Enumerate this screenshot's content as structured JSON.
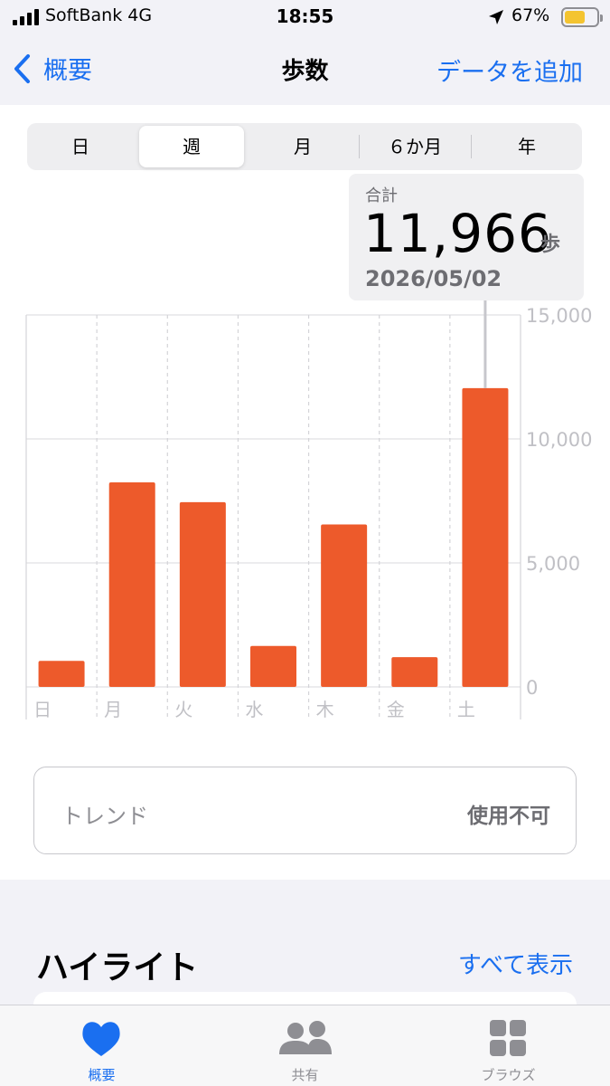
{
  "status_bar": {
    "carrier": "SoftBank   4G",
    "time": "18:55",
    "battery": "67%"
  },
  "nav": {
    "back": "概要",
    "title": "歩数",
    "add": "データを追加"
  },
  "segments": [
    {
      "label": "日",
      "selected": false
    },
    {
      "label": "週",
      "selected": true
    },
    {
      "label": "月",
      "selected": false
    },
    {
      "label": "６か月",
      "selected": false
    },
    {
      "label": "年",
      "selected": false
    }
  ],
  "summary": {
    "label": "合計",
    "value": "11,966",
    "unit": "歩",
    "date": "2026/05/02"
  },
  "chart_data": {
    "type": "bar",
    "categories": [
      "日",
      "月",
      "火",
      "水",
      "木",
      "金",
      "土"
    ],
    "values": [
      1050,
      8250,
      7450,
      1650,
      6550,
      1200,
      12050
    ],
    "highlight_index": 6,
    "ylim": [
      0,
      15000
    ],
    "yticks": [
      "0",
      "5,000",
      "10,000",
      "15,000"
    ],
    "ytick_values": [
      0,
      5000,
      10000,
      15000
    ],
    "bar_color": "#ed5a2b",
    "grid": true
  },
  "trend": {
    "label": "トレンド",
    "status": "使用不可"
  },
  "highlights": {
    "title": "ハイライト",
    "see_all": "すべて表示"
  },
  "tabs": [
    {
      "label": "概要",
      "icon": "heart-icon",
      "active": true
    },
    {
      "label": "共有",
      "icon": "people-icon",
      "active": false
    },
    {
      "label": "ブラウズ",
      "icon": "grid-icon",
      "active": false
    }
  ],
  "colors": {
    "accent": "#1a6ff0",
    "bar": "#ed5a2b"
  }
}
